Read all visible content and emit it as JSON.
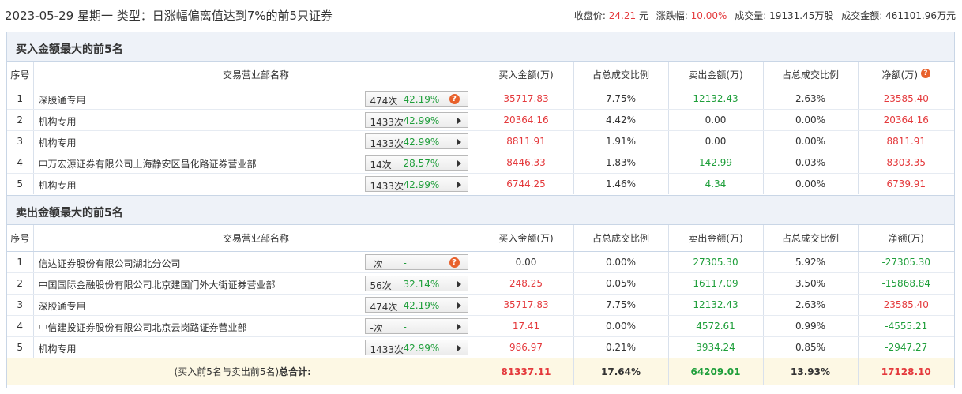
{
  "header": {
    "title": "2023-05-29 星期一 类型：日涨幅偏离值达到7%的前5只证券",
    "close_label": "收盘价:",
    "close_value": "24.21",
    "close_unit": "元",
    "change_label": "涨跌幅:",
    "change_value": "10.00%",
    "volume_label": "成交量:",
    "volume_value": "19131.45万股",
    "amount_label": "成交金额:",
    "amount_value": "461101.96万元"
  },
  "columns": {
    "rank": "序号",
    "name": "交易营业部名称",
    "buy_amount": "买入金额(万)",
    "buy_ratio": "占总成交比例",
    "sell_amount": "卖出金额(万)",
    "sell_ratio": "占总成交比例",
    "net": "净额(万)"
  },
  "buy_section": {
    "title": "买入金额最大的前5名",
    "rows": [
      {
        "rank": "1",
        "name": "深股通专用",
        "count": "474次",
        "pct": "42.19%",
        "icon": "question-icon",
        "buy": "35717.83",
        "buy_ratio": "7.75%",
        "sell": "12132.43",
        "sell_ratio": "2.63%",
        "net": "23585.40"
      },
      {
        "rank": "2",
        "name": "机构专用",
        "count": "1433次",
        "pct": "42.99%",
        "icon": "arrow-right-icon",
        "buy": "20364.16",
        "buy_ratio": "4.42%",
        "sell": "0.00",
        "sell_ratio": "0.00%",
        "net": "20364.16"
      },
      {
        "rank": "3",
        "name": "机构专用",
        "count": "1433次",
        "pct": "42.99%",
        "icon": "arrow-right-icon",
        "buy": "8811.91",
        "buy_ratio": "1.91%",
        "sell": "0.00",
        "sell_ratio": "0.00%",
        "net": "8811.91"
      },
      {
        "rank": "4",
        "name": "申万宏源证券有限公司上海静安区昌化路证券营业部",
        "count": "14次",
        "pct": "28.57%",
        "icon": "arrow-right-icon",
        "buy": "8446.33",
        "buy_ratio": "1.83%",
        "sell": "142.99",
        "sell_ratio": "0.03%",
        "net": "8303.35"
      },
      {
        "rank": "5",
        "name": "机构专用",
        "count": "1433次",
        "pct": "42.99%",
        "icon": "arrow-right-icon",
        "buy": "6744.25",
        "buy_ratio": "1.46%",
        "sell": "4.34",
        "sell_ratio": "0.00%",
        "net": "6739.91"
      }
    ]
  },
  "sell_section": {
    "title": "卖出金额最大的前5名",
    "rows": [
      {
        "rank": "1",
        "name": "信达证券股份有限公司湖北分公司",
        "count": "-次",
        "pct": "-",
        "icon": "question-icon",
        "buy": "0.00",
        "buy_ratio": "0.00%",
        "sell": "27305.30",
        "sell_ratio": "5.92%",
        "net": "-27305.30"
      },
      {
        "rank": "2",
        "name": "中国国际金融股份有限公司北京建国门外大街证券营业部",
        "count": "56次",
        "pct": "32.14%",
        "icon": "arrow-right-icon",
        "buy": "248.25",
        "buy_ratio": "0.05%",
        "sell": "16117.09",
        "sell_ratio": "3.50%",
        "net": "-15868.84"
      },
      {
        "rank": "3",
        "name": "深股通专用",
        "count": "474次",
        "pct": "42.19%",
        "icon": "arrow-right-icon",
        "buy": "35717.83",
        "buy_ratio": "7.75%",
        "sell": "12132.43",
        "sell_ratio": "2.63%",
        "net": "23585.40"
      },
      {
        "rank": "4",
        "name": "中信建投证券股份有限公司北京云岗路证券营业部",
        "count": "-次",
        "pct": "-",
        "icon": "arrow-right-icon",
        "buy": "17.41",
        "buy_ratio": "0.00%",
        "sell": "4572.61",
        "sell_ratio": "0.99%",
        "net": "-4555.21"
      },
      {
        "rank": "5",
        "name": "机构专用",
        "count": "1433次",
        "pct": "42.99%",
        "icon": "arrow-right-icon",
        "buy": "986.97",
        "buy_ratio": "0.21%",
        "sell": "3934.24",
        "sell_ratio": "0.85%",
        "net": "-2947.27"
      }
    ]
  },
  "total": {
    "label_prefix": "(买入前5名与卖出前5名)",
    "label_bold": "总合计:",
    "buy": "81337.11",
    "buy_ratio": "17.64%",
    "sell": "64209.01",
    "sell_ratio": "13.93%",
    "net": "17128.10"
  },
  "colors": {
    "red": "#e4393c",
    "green": "#1e9e3a",
    "header_bg": "#eef2f8",
    "total_bg": "#fdf8e4",
    "icon_orange": "#e8612c"
  }
}
